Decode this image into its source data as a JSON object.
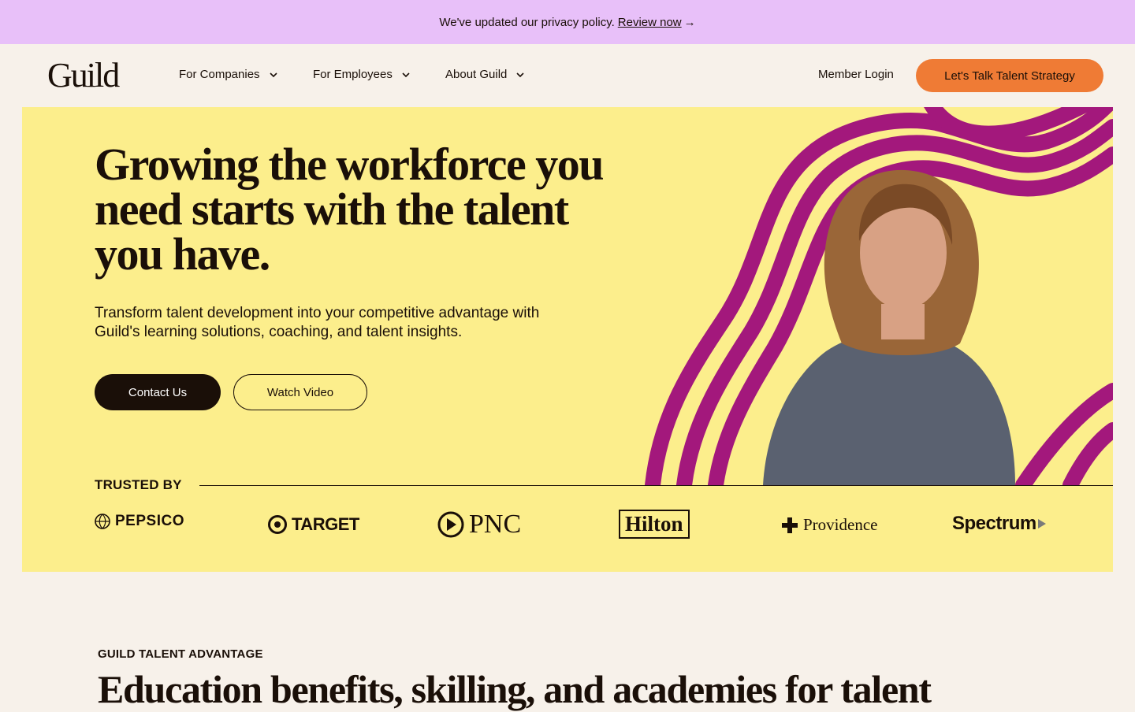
{
  "banner": {
    "text": "We've updated our privacy policy.",
    "link": "Review now",
    "arrow": "→"
  },
  "nav": {
    "logo": "Guild",
    "items": [
      {
        "label": "For Companies"
      },
      {
        "label": "For Employees"
      },
      {
        "label": "About Guild"
      }
    ],
    "member_login": "Member Login",
    "cta": "Let's Talk Talent Strategy"
  },
  "hero": {
    "title": "Growing the workforce you need starts with the talent you have.",
    "subtitle": "Transform talent development into your competitive advantage with Guild's learning solutions, coaching, and talent insights.",
    "contact_button": "Contact Us",
    "watch_button": "Watch Video",
    "trusted_label": "TRUSTED BY",
    "logos": [
      "PEPSICO",
      "TARGET",
      "PNC",
      "Hilton",
      "Providence",
      "Spectrum"
    ]
  },
  "section": {
    "label": "GUILD TALENT ADVANTAGE",
    "title": "Education benefits, skilling, and academies for talent"
  },
  "colors": {
    "banner": "#e8c0f9",
    "page": "#f7f1ea",
    "hero": "#fcee8c",
    "cta": "#ef7b35",
    "stripe": "#a3187c",
    "ink": "#1a0f08"
  },
  "icons": [
    "chevron-down-icon",
    "arrow-right-icon",
    "play-icon"
  ]
}
